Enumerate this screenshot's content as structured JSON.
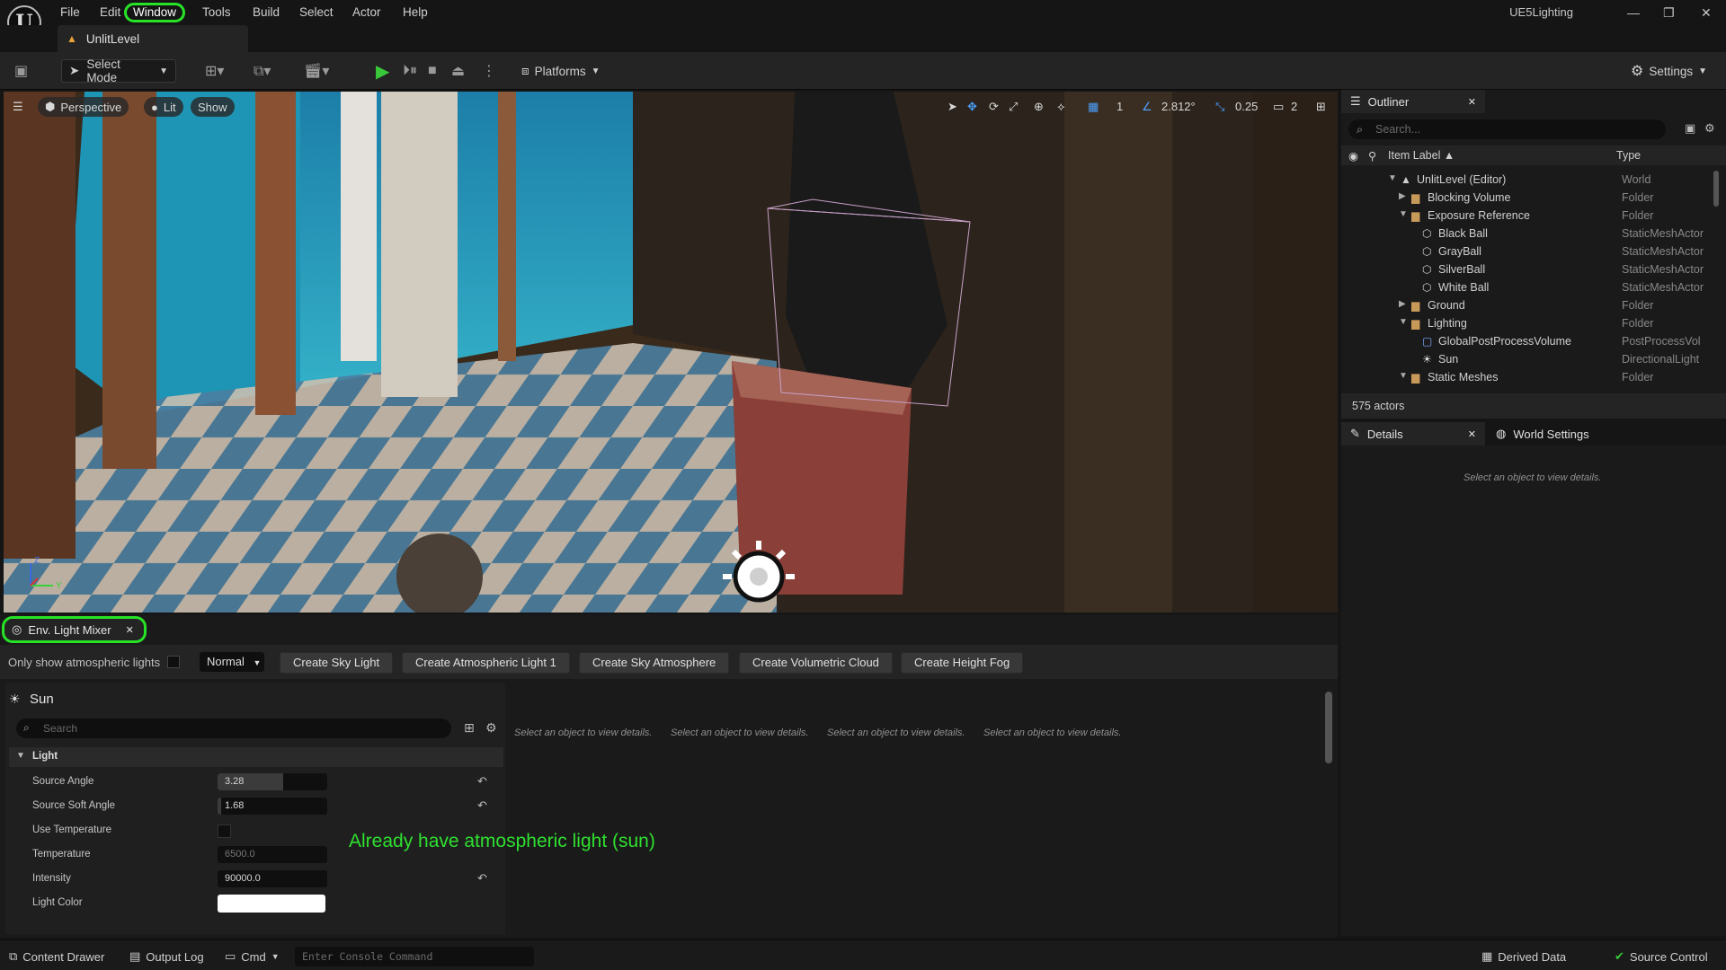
{
  "app": {
    "logo_icon": "unreal-engine-logo-icon",
    "logo_text": "U",
    "project_name": "UE5Lighting",
    "menu": [
      "File",
      "Edit",
      "Window",
      "Tools",
      "Build",
      "Select",
      "Actor",
      "Help"
    ],
    "highlighted_menu": "Window",
    "highlight_color": "#27e327"
  },
  "level_tab": {
    "label": "UnlitLevel"
  },
  "toolbar": {
    "select_mode": "Select Mode",
    "platforms": "Platforms",
    "settings": "Settings"
  },
  "viewport": {
    "perspective": "Perspective",
    "lit": "Lit",
    "show": "Show",
    "grid_snap": "1",
    "rotation_snap": "2.812°",
    "scale_snap": "0.25",
    "camera_speed": "2",
    "axis_z": "Z",
    "axis_y": "Y"
  },
  "mixer": {
    "tab_label": "Env. Light Mixer",
    "only_atmospheric_label": "Only show atmospheric lights",
    "mode_select": "Normal",
    "buttons": [
      "Create Sky Light",
      "Create Atmospheric Light 1",
      "Create Sky Atmosphere",
      "Create Volumetric Cloud",
      "Create Height Fog"
    ],
    "sun_title": "Sun",
    "search_placeholder": "Search",
    "category": "Light",
    "properties": [
      {
        "label": "Source Angle",
        "value": "3.28",
        "fill": 0.6
      },
      {
        "label": "Source Soft Angle",
        "value": "1.68",
        "fill": 0.03
      },
      {
        "label": "Use Temperature",
        "value": "",
        "fill": 0
      },
      {
        "label": "Temperature",
        "value": "6500.0",
        "fill": 0
      },
      {
        "label": "Intensity",
        "value": "90000.0",
        "fill": 0
      },
      {
        "label": "Light Color",
        "value": "",
        "fill": 0
      }
    ],
    "details_msg": "Select an object to view details."
  },
  "outliner": {
    "tab_label": "Outliner",
    "search_placeholder": "Search...",
    "col_label": "Item Label ▲",
    "col_type": "Type",
    "rows": [
      {
        "label": "UnlitLevel (Editor)",
        "type": "World",
        "indent": 0,
        "arrow": "▼",
        "icon": "level-icon"
      },
      {
        "label": "Blocking Volume",
        "type": "Folder",
        "indent": 1,
        "arrow": "▶",
        "icon": "folder-icon"
      },
      {
        "label": "Exposure Reference",
        "type": "Folder",
        "indent": 1,
        "arrow": "▼",
        "icon": "folder-icon"
      },
      {
        "label": "Black Ball",
        "type": "StaticMeshActor",
        "indent": 2,
        "arrow": "",
        "icon": "mesh-icon"
      },
      {
        "label": "GrayBall",
        "type": "StaticMeshActor",
        "indent": 2,
        "arrow": "",
        "icon": "mesh-icon"
      },
      {
        "label": "SilverBall",
        "type": "StaticMeshActor",
        "indent": 2,
        "arrow": "",
        "icon": "mesh-icon"
      },
      {
        "label": "White Ball",
        "type": "StaticMeshActor",
        "indent": 2,
        "arrow": "",
        "icon": "mesh-icon"
      },
      {
        "label": "Ground",
        "type": "Folder",
        "indent": 1,
        "arrow": "▶",
        "icon": "folder-icon"
      },
      {
        "label": "Lighting",
        "type": "Folder",
        "indent": 1,
        "arrow": "▼",
        "icon": "folder-icon"
      },
      {
        "label": "GlobalPostProcessVolume",
        "type": "PostProcessVol",
        "indent": 2,
        "arrow": "",
        "icon": "volume-icon"
      },
      {
        "label": "Sun",
        "type": "DirectionalLight",
        "indent": 2,
        "arrow": "",
        "icon": "sun-icon"
      },
      {
        "label": "Static Meshes",
        "type": "Folder",
        "indent": 1,
        "arrow": "▼",
        "icon": "folder-icon"
      }
    ],
    "actor_count": "575 actors"
  },
  "details": {
    "tab_label": "Details",
    "world_settings": "World Settings",
    "empty_msg": "Select an object to view details."
  },
  "statusbar": {
    "content_drawer": "Content Drawer",
    "output_log": "Output Log",
    "cmd": "Cmd",
    "console_placeholder": "Enter Console Command",
    "derived_data": "Derived Data",
    "source_control": "Source Control"
  },
  "annotation": {
    "text": "Already have atmospheric light (sun)",
    "color": "#2fe02f"
  }
}
